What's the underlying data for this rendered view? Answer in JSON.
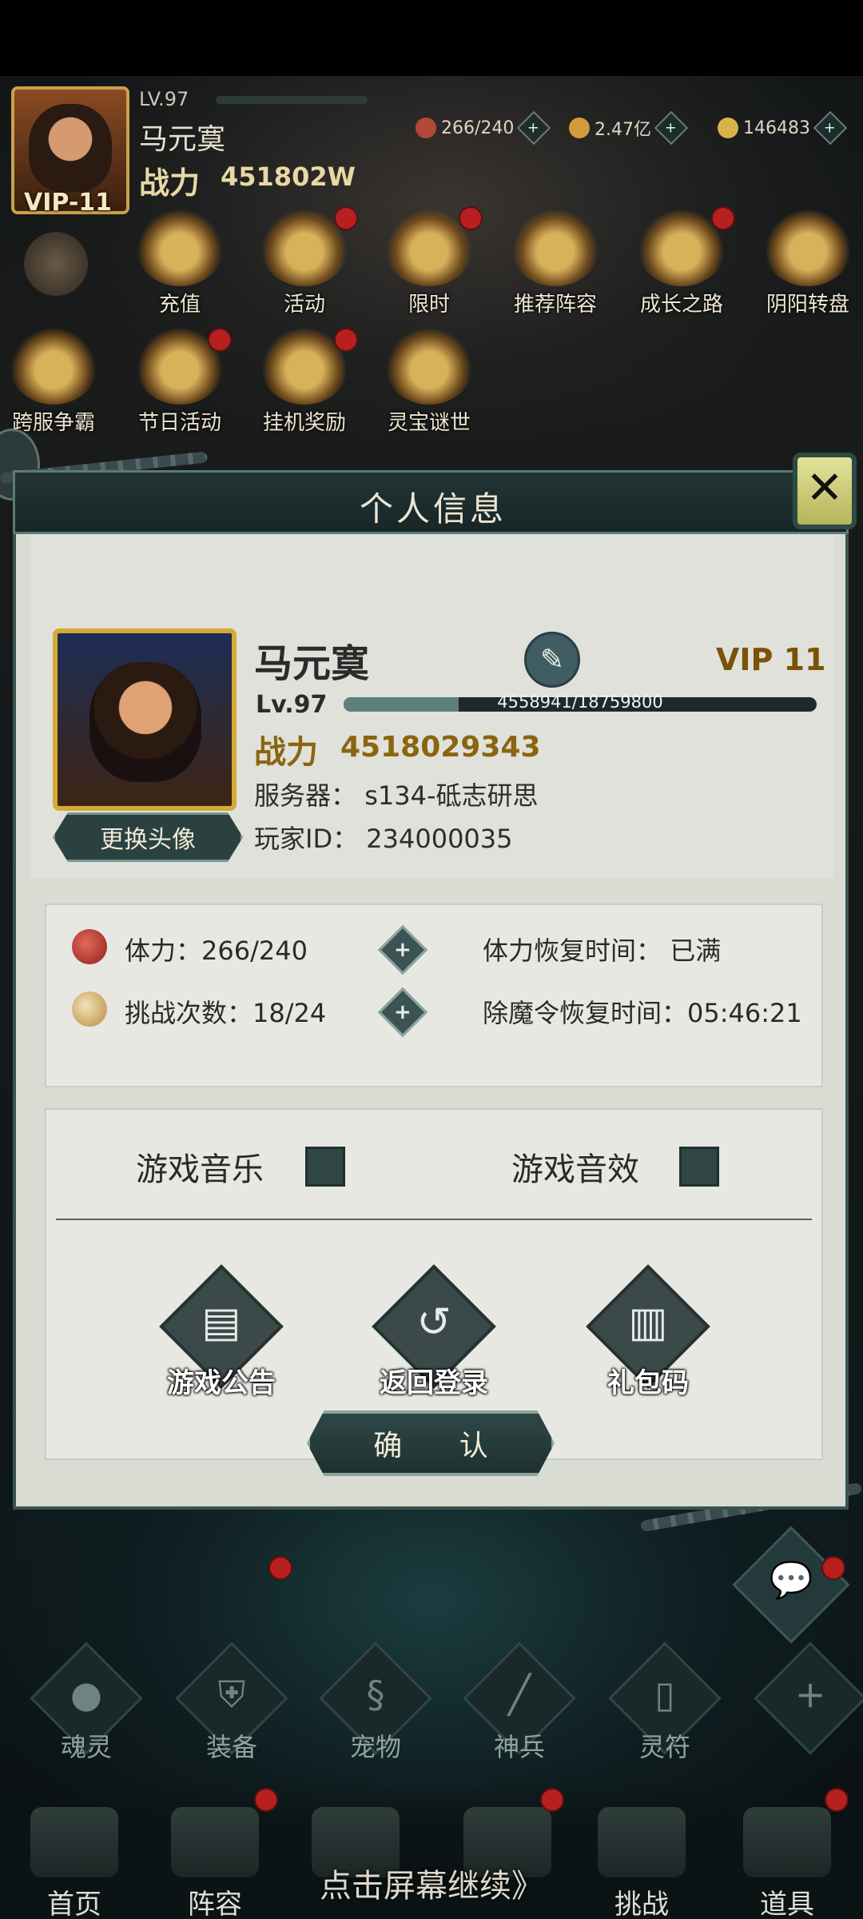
{
  "hud": {
    "level": "LV.97",
    "name": "马元寞",
    "power_label": "战力",
    "power": "451802W",
    "vip": "VIP-11",
    "resources": [
      {
        "name": "stamina",
        "value": "266/240",
        "icon": "peach-icon",
        "color": "#b5473a"
      },
      {
        "name": "gold",
        "value": "2.47亿",
        "icon": "gold-icon",
        "color": "#d49b3a"
      },
      {
        "name": "ingot",
        "value": "146483",
        "icon": "ingot-icon",
        "color": "#d9b24a"
      }
    ]
  },
  "activities": [
    {
      "label": "充值",
      "dot": false
    },
    {
      "label": "活动",
      "dot": true
    },
    {
      "label": "限时",
      "dot": true
    },
    {
      "label": "推荐阵容",
      "dot": false
    },
    {
      "label": "成长之路",
      "dot": true
    },
    {
      "label": "阴阳转盘",
      "dot": false
    },
    {
      "label": "跨服争霸",
      "dot": false
    },
    {
      "label": "节日活动",
      "dot": true
    },
    {
      "label": "挂机奖励",
      "dot": true
    },
    {
      "label": "灵宝谜世",
      "dot": false
    }
  ],
  "modal": {
    "title": "个人信息",
    "close_icon": "close-icon",
    "profile": {
      "name": "马元寞",
      "vip": "VIP 11",
      "level": "Lv.97",
      "exp_text": "4558941/18759800",
      "exp_fraction": 0.243,
      "power_label": "战力",
      "power": "4518029343",
      "server_label": "服务器：",
      "server": "s134-砥志研思",
      "id_label": "玩家ID：",
      "id": "234000035",
      "change_avatar": "更换头像"
    },
    "stats": {
      "stamina_label": "体力：",
      "stamina": "266/240",
      "stamina_recover_label": "体力恢复时间：",
      "stamina_recover": "已满",
      "challenge_label": "挑战次数：",
      "challenge": "18/24",
      "demon_recover_label": "除魔令恢复时间：",
      "demon_recover": "05:46:21"
    },
    "settings": {
      "music_label": "游戏音乐",
      "sound_label": "游戏音效"
    },
    "actions": [
      {
        "label": "游戏公告",
        "icon": "notice-icon"
      },
      {
        "label": "返回登录",
        "icon": "return-icon"
      },
      {
        "label": "礼包码",
        "icon": "gift-code-icon"
      }
    ],
    "confirm": "确 认"
  },
  "equip": [
    {
      "label": "魂灵",
      "dot": false
    },
    {
      "label": "装备",
      "dot": true
    },
    {
      "label": "宠物",
      "dot": false
    },
    {
      "label": "神兵",
      "dot": false
    },
    {
      "label": "灵符",
      "dot": false
    },
    {
      "label": "",
      "dot": true
    }
  ],
  "nav": [
    {
      "label": "首页",
      "dot": false
    },
    {
      "label": "阵容",
      "dot": true
    },
    {
      "label": "",
      "dot": false
    },
    {
      "label": "",
      "dot": true
    },
    {
      "label": "挑战",
      "dot": false
    },
    {
      "label": "道具",
      "dot": true
    }
  ],
  "tap_continue": "点击屏幕继续》"
}
